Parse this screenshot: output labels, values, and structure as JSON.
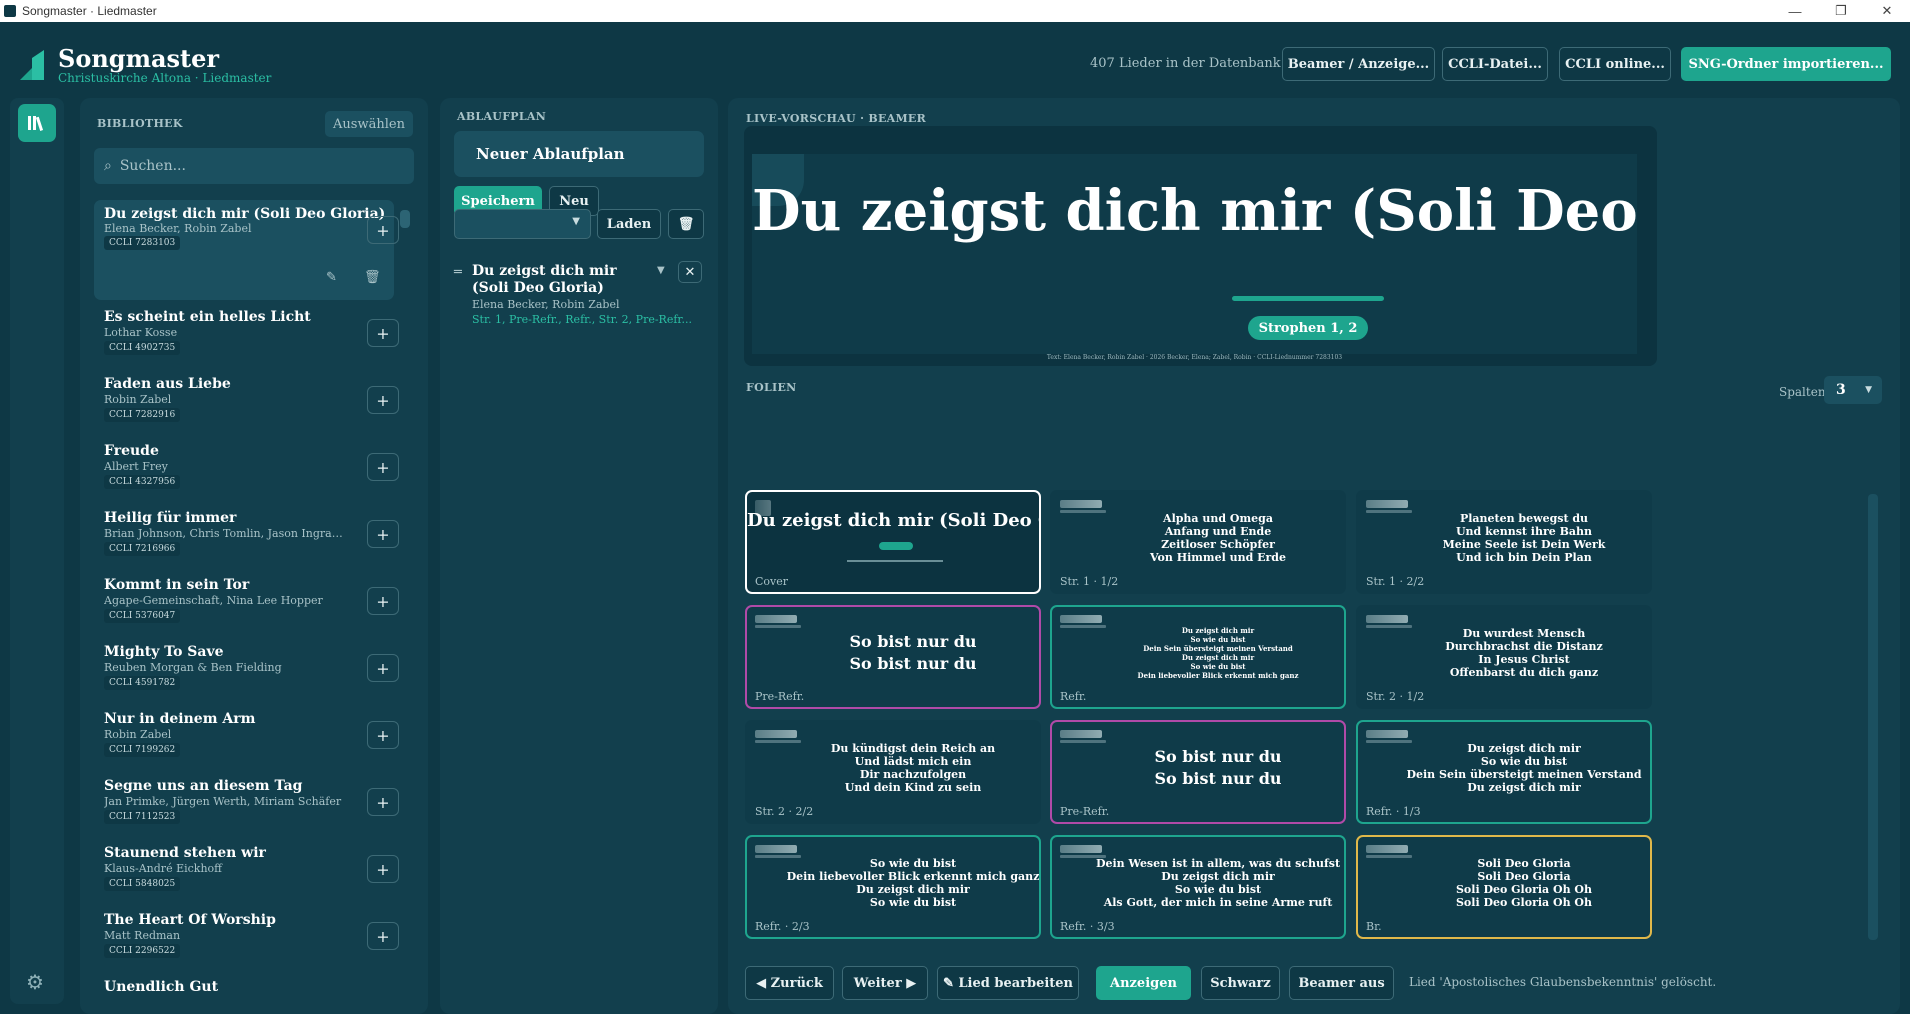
{
  "window": {
    "title": "Songmaster · Liedmaster",
    "controls": [
      "—",
      "❐",
      "✕"
    ]
  },
  "header": {
    "brand": "Songmaster",
    "subtitle": "Christuskirche Altona · Liedmaster",
    "song_count": "407 Lieder in der Datenbank",
    "buttons": [
      "Beamer / Anzeige...",
      "CCLI-Datei...",
      "CCLI online...",
      "SNG-Ordner importieren..."
    ]
  },
  "library": {
    "title": "BIBLIOTHEK",
    "select_label": "Auswählen",
    "search_placeholder": "Suchen...",
    "songs": [
      {
        "title": "Du zeigst dich mir (Soli Deo Gloria)",
        "artist": "Elena Becker, Robin Zabel",
        "ccli": "CCLI 7283103"
      },
      {
        "title": "Es scheint ein helles Licht",
        "artist": "Lothar Kosse",
        "ccli": "CCLI 4902735"
      },
      {
        "title": "Faden aus Liebe",
        "artist": "Robin Zabel",
        "ccli": "CCLI 7282916"
      },
      {
        "title": "Freude",
        "artist": "Albert Frey",
        "ccli": "CCLI 4327956"
      },
      {
        "title": "Heilig für immer",
        "artist": "Brian Johnson, Chris Tomlin, Jason Ingram, Jonathan Lindley Smith",
        "ccli": "CCLI 7216966"
      },
      {
        "title": "Kommt in sein Tor",
        "artist": "Agape-Gemeinschaft, Nina Lee Hopper",
        "ccli": "CCLI 5376047"
      },
      {
        "title": "Mighty To Save",
        "artist": "Reuben Morgan & Ben Fielding",
        "ccli": "CCLI 4591782"
      },
      {
        "title": "Nur in deinem Arm",
        "artist": "Robin Zabel",
        "ccli": "CCLI 7199262"
      },
      {
        "title": "Segne uns an diesem Tag",
        "artist": "Jan Primke, Jürgen Werth, Miriam Schäfer",
        "ccli": "CCLI 7112523"
      },
      {
        "title": "Staunend stehen wir",
        "artist": "Klaus-André Eickhoff",
        "ccli": "CCLI 5848025"
      },
      {
        "title": "The Heart Of Worship",
        "artist": "Matt Redman",
        "ccli": "CCLI 2296522"
      },
      {
        "title": "Unendlich Gut",
        "artist": "",
        "ccli": ""
      }
    ]
  },
  "setlist": {
    "title": "ABLAUFPLAN",
    "name_value": "Neuer Ablaufplan",
    "save": "Speichern",
    "new": "Neu",
    "load": "Laden",
    "item": {
      "title_l1": "Du zeigst dich mir",
      "title_l2": "(Soli Deo Gloria)",
      "artist": "Elena Becker, Robin Zabel",
      "order": "Str. 1, Pre-Refr., Refr., Str. 2, Pre-Refr..."
    }
  },
  "preview": {
    "title": "LIVE-VORSCHAU · BEAMER",
    "slide_title": "Du zeigst dich mir (Soli Deo Gloria)",
    "pill": "Strophen 1, 2",
    "credit": "Text: Elena Becker, Robin Zabel · 2026 Becker, Elena; Zabel, Robin · CCLI-Liednummer 7283103"
  },
  "slides": {
    "title": "FOLIEN",
    "columns_label": "Spalten",
    "columns_value": "3",
    "cover": {
      "title": "Du zeigst dich mir (Soli Deo Gloria)",
      "label": "Cover"
    },
    "cards": [
      {
        "label": "Str. 1 · 1/2",
        "lines": [
          "Alpha und Omega",
          "Anfang und Ende",
          "Zeitloser Schöpfer",
          "Von Himmel und Erde"
        ]
      },
      {
        "label": "Str. 1 · 2/2",
        "lines": [
          "Planeten bewegst du",
          "Und kennst ihre Bahn",
          "Meine Seele ist Dein Werk",
          "Und ich bin Dein Plan"
        ]
      },
      {
        "label": "Pre-Refr.",
        "lines": [
          "So bist nur du",
          "So bist nur du"
        ]
      },
      {
        "label": "Refr.",
        "lines": [
          "Du zeigst dich mir",
          "So wie du bist",
          "Dein Sein übersteigt meinen Verstand",
          "Du zeigst dich mir",
          "So wie du bist",
          "Dein liebevoller Blick erkennt mich ganz"
        ]
      },
      {
        "label": "Str. 2 · 1/2",
        "lines": [
          "Du wurdest Mensch",
          "Durchbrachst die Distanz",
          "In Jesus Christ",
          "Offenbarst du dich ganz"
        ]
      },
      {
        "label": "Str. 2 · 2/2",
        "lines": [
          "Du kündigst dein Reich an",
          "Und lädst mich ein",
          "Dir nachzufolgen",
          "Und dein Kind zu sein"
        ]
      },
      {
        "label": "Pre-Refr.",
        "lines": [
          "So bist nur du",
          "So bist nur du"
        ]
      },
      {
        "label": "Refr. · 1/3",
        "lines": [
          "Du zeigst dich mir",
          "So wie du bist",
          "Dein Sein übersteigt meinen Verstand",
          "Du zeigst dich mir"
        ]
      },
      {
        "label": "Refr. · 2/3",
        "lines": [
          "So wie du bist",
          "Dein liebevoller Blick erkennt mich ganz",
          "Du zeigst dich mir",
          "So wie du bist"
        ]
      },
      {
        "label": "Refr. · 3/3",
        "lines": [
          "Dein Wesen ist in allem, was du schufst",
          "Du zeigst dich mir",
          "So wie du bist",
          "Als Gott, der mich in seine Arme ruft"
        ]
      },
      {
        "label": "Br.",
        "lines": [
          "Soli Deo Gloria",
          "Soli Deo Gloria",
          "Soli Deo Gloria Oh Oh",
          "Soli Deo Gloria Oh Oh"
        ]
      }
    ]
  },
  "footer": {
    "back": "◀ Zurück",
    "next": "Weiter ▶",
    "edit": "✎ Lied bearbeiten",
    "show": "Anzeigen",
    "black": "Schwarz",
    "beamer_off": "Beamer aus",
    "status": "Lied 'Apostolisches Glaubensbekenntnis' gelöscht."
  },
  "colors": {
    "accent": "#1ea58e",
    "background": "#0e3845",
    "panel": "#123f4d",
    "pre_refrain_border": "#b04aa8",
    "bridge_border": "#e0b84a"
  }
}
